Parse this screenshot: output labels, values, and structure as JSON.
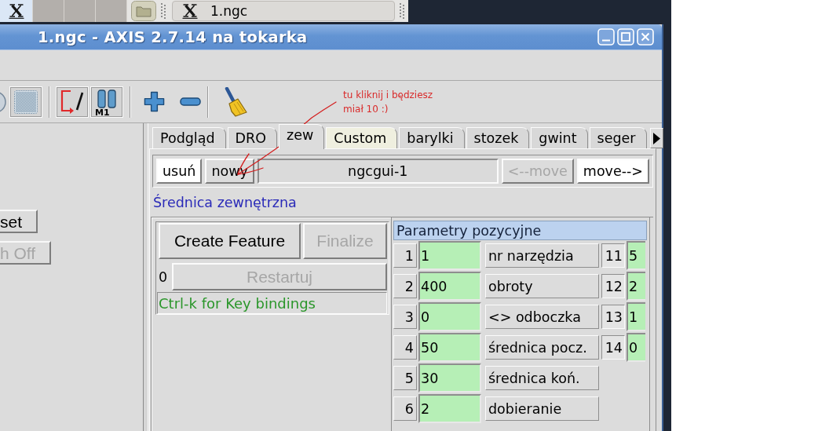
{
  "taskbar": {
    "pager": [
      {
        "selected": true
      },
      {
        "selected": false
      },
      {
        "selected": false
      },
      {
        "selected": false
      }
    ],
    "task": {
      "label": "1.ngc"
    }
  },
  "window": {
    "title": "1.ngc - AXIS 2.7.14 na tokarka"
  },
  "toolbar": [
    {
      "kind": "partial"
    },
    {
      "kind": "dotted-square",
      "pressed": true
    },
    {
      "kind": "separator"
    },
    {
      "kind": "block-delete",
      "pressed": true
    },
    {
      "kind": "optional-stop",
      "pressed": true,
      "label": "M1"
    },
    {
      "kind": "separator"
    },
    {
      "kind": "zoom-in"
    },
    {
      "kind": "zoom-out"
    },
    {
      "kind": "separator"
    },
    {
      "kind": "clear"
    }
  ],
  "left_pane": {
    "buttons": [
      {
        "label": "set",
        "disabled": false
      },
      {
        "label": "h Off",
        "disabled": true
      }
    ]
  },
  "tabs": [
    {
      "label": "Podgląd",
      "selected": false,
      "hovered": false
    },
    {
      "label": "DRO",
      "selected": false,
      "hovered": false
    },
    {
      "label": "zew",
      "selected": true,
      "hovered": false
    },
    {
      "label": "Custom",
      "selected": false,
      "hovered": true
    },
    {
      "label": "barylki",
      "selected": false,
      "hovered": false
    },
    {
      "label": "stozek",
      "selected": false,
      "hovered": false
    },
    {
      "label": "gwint",
      "selected": false,
      "hovered": false
    },
    {
      "label": "seger",
      "selected": false,
      "hovered": false
    }
  ],
  "feature_bar": [
    {
      "kind": "button",
      "label": "usuń",
      "disabled": false,
      "highlighted": true
    },
    {
      "kind": "button",
      "label": "nowy",
      "disabled": false,
      "highlighted": false
    },
    {
      "kind": "field",
      "value": "ngcgui-1"
    },
    {
      "kind": "button",
      "label": "<--move",
      "disabled": true,
      "highlighted": false
    },
    {
      "kind": "button",
      "label": "move-->",
      "disabled": false,
      "highlighted": true
    }
  ],
  "feature_title": "Średnica zewnętrzna",
  "controls": {
    "create": {
      "label": "Create Feature",
      "disabled": false
    },
    "finalize": {
      "label": "Finalize",
      "disabled": true
    },
    "restart_count": "0",
    "restart": {
      "label": "Restartuj",
      "disabled": true
    },
    "hint": "Ctrl-k for Key bindings"
  },
  "parameters": {
    "title": "Parametry pozycyjne",
    "rows": [
      {
        "number": "1",
        "value": "1",
        "label": "nr narzędzia",
        "extra_number": "11",
        "extra_value": "5"
      },
      {
        "number": "2",
        "value": "400",
        "label": "obroty",
        "extra_number": "12",
        "extra_value": "2"
      },
      {
        "number": "3",
        "value": "0",
        "label": "<> odboczka",
        "extra_number": "13",
        "extra_value": "1"
      },
      {
        "number": "4",
        "value": "50",
        "label": "średnica pocz.",
        "extra_number": "14",
        "extra_value": "0"
      },
      {
        "number": "5",
        "value": "30",
        "label": "średnica koń."
      },
      {
        "number": "6",
        "value": "2",
        "label": "dobieranie"
      }
    ]
  },
  "annotation": {
    "text": "tu kliknij i będziesz\nmiał 10 :)"
  }
}
